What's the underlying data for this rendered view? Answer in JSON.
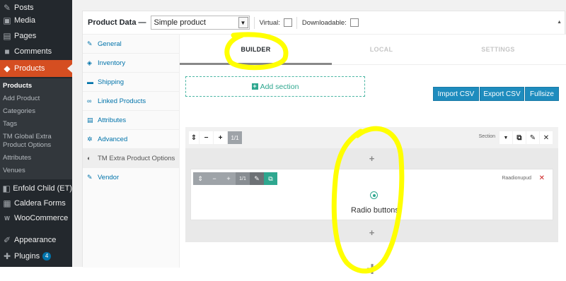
{
  "sidebar": {
    "items": [
      {
        "label": "Posts",
        "icon": "pin-icon",
        "glyph": "✎"
      },
      {
        "label": "Media",
        "icon": "media-icon",
        "glyph": "▣"
      },
      {
        "label": "Pages",
        "icon": "pages-icon",
        "glyph": "▤"
      },
      {
        "label": "Comments",
        "icon": "comments-icon",
        "glyph": "■"
      },
      {
        "label": "Products",
        "icon": "products-icon",
        "glyph": "◆"
      },
      {
        "label": "Enfold Child (ET)",
        "icon": "theme-icon",
        "glyph": "◧"
      },
      {
        "label": "Caldera Forms",
        "icon": "forms-icon",
        "glyph": "▦"
      },
      {
        "label": "WooCommerce",
        "icon": "woocommerce-icon",
        "glyph": "W"
      },
      {
        "label": "Appearance",
        "icon": "appearance-icon",
        "glyph": "✐"
      },
      {
        "label": "Plugins",
        "icon": "plugins-icon",
        "glyph": "✚",
        "badge": "4"
      }
    ],
    "submenu": [
      "Products",
      "Add Product",
      "Categories",
      "Tags",
      "TM Global Extra",
      "Product Options",
      "Attributes",
      "Venues"
    ]
  },
  "product_data": {
    "title": "Product Data —",
    "product_type": "Simple product",
    "virtual_label": "Virtual:",
    "downloadable_label": "Downloadable:",
    "tabs": [
      {
        "label": "General",
        "glyph": "✎"
      },
      {
        "label": "Inventory",
        "glyph": "◈"
      },
      {
        "label": "Shipping",
        "glyph": "▬"
      },
      {
        "label": "Linked Products",
        "glyph": "∞"
      },
      {
        "label": "Attributes",
        "glyph": "▤"
      },
      {
        "label": "Advanced",
        "glyph": "✲"
      },
      {
        "label": "TM Extra Product Options",
        "glyph": "◐"
      },
      {
        "label": "Vendor",
        "glyph": "✎"
      }
    ]
  },
  "builder": {
    "tabs": [
      "BUILDER",
      "LOCAL",
      "SETTINGS"
    ],
    "add_section": "Add section",
    "buttons": {
      "import": "Import CSV",
      "export": "Export CSV",
      "fullsize": "Fullsize"
    },
    "section": {
      "size": "1/1",
      "label": "Section",
      "field": {
        "size": "1/1",
        "name": "Raadionupud",
        "label": "Radio buttons"
      }
    }
  },
  "colors": {
    "sidebar_bg": "#23282d",
    "active_menu": "#d54e21",
    "accent_blue": "#1e8cbe",
    "accent_green": "#2ea78f",
    "highlight_yellow": "#ffff00"
  }
}
